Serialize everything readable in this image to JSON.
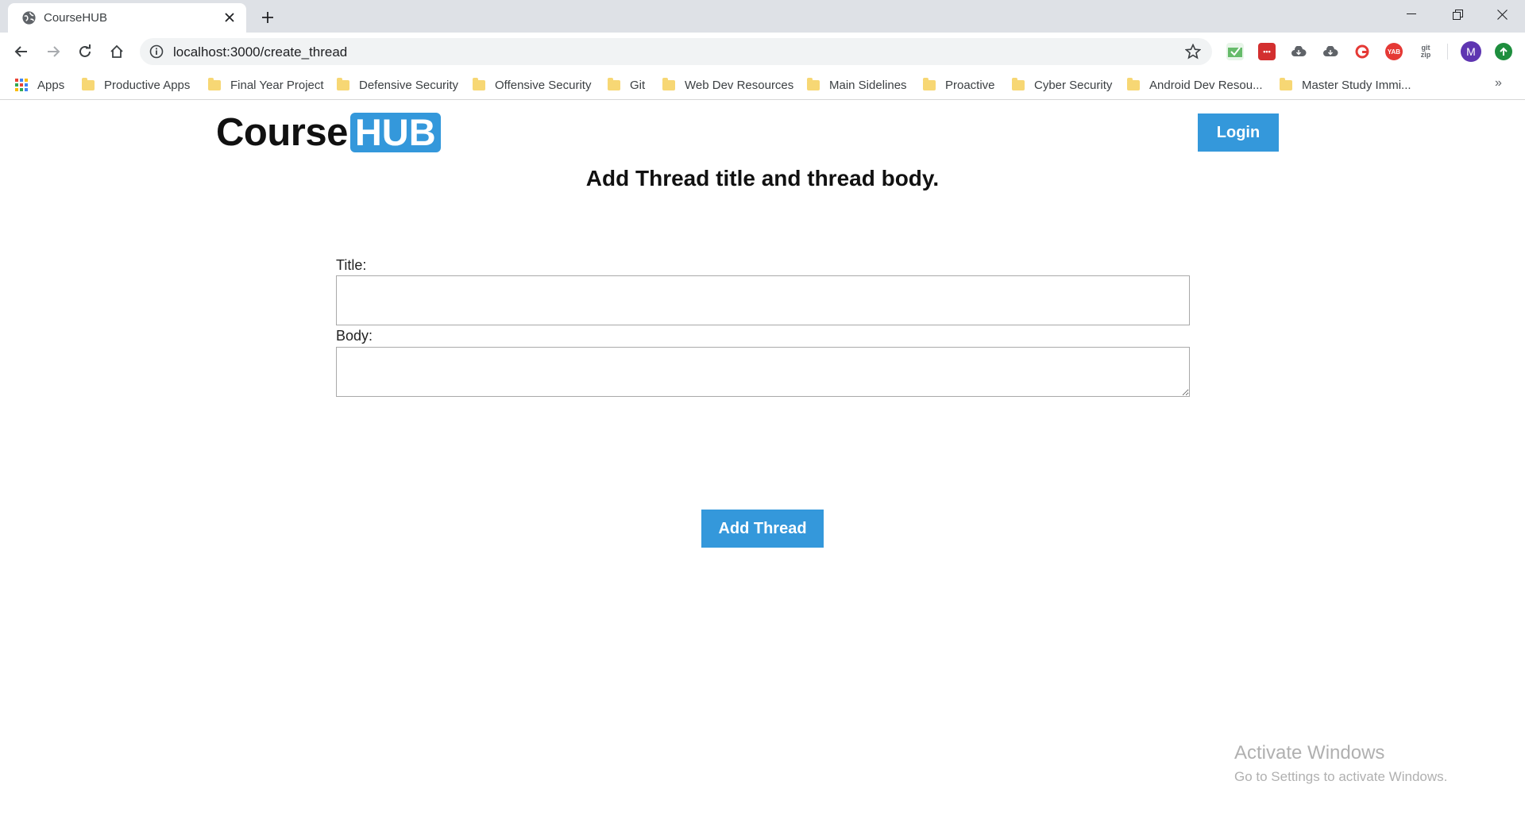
{
  "browser": {
    "tab_title": "CourseHUB",
    "url": "localhost:3000/create_thread",
    "profile_initial": "M",
    "bookmarks": [
      "Apps",
      "Productive Apps",
      "Final Year Project",
      "Defensive Security",
      "Offensive Security",
      "Git",
      "Web Dev Resources",
      "Main Sidelines",
      "Proactive",
      "Cyber Security",
      "Android Dev Resou...",
      "Master Study Immi..."
    ],
    "more_bookmarks": "»",
    "extensions": [
      {
        "name": "mail-check-icon",
        "color": "#4caf50",
        "label": ""
      },
      {
        "name": "lastpass-icon",
        "color": "#d32f2f",
        "label": "•••"
      },
      {
        "name": "cloud-icon",
        "color": "#5f6368",
        "label": ""
      },
      {
        "name": "cloud-download-icon",
        "color": "#5f6368",
        "label": ""
      },
      {
        "name": "grammarly-icon",
        "color": "#e53935",
        "label": ""
      },
      {
        "name": "yab-icon",
        "color": "#e53935",
        "label": "YAB"
      },
      {
        "name": "gitzip-icon",
        "color": "#5f6368",
        "label": "git zip"
      }
    ],
    "update_color": "#1e8e3e",
    "profile_color": "#5e35b1"
  },
  "site": {
    "logo_course": "Course",
    "logo_hub": "HUB",
    "login_label": "Login",
    "heading": "Add Thread title and thread body.",
    "title_label": "Title:",
    "title_value": "",
    "body_label": "Body:",
    "body_value": "",
    "submit_label": "Add Thread",
    "accent": "#3498db"
  },
  "watermark": {
    "line1": "Activate Windows",
    "line2": "Go to Settings to activate Windows."
  }
}
